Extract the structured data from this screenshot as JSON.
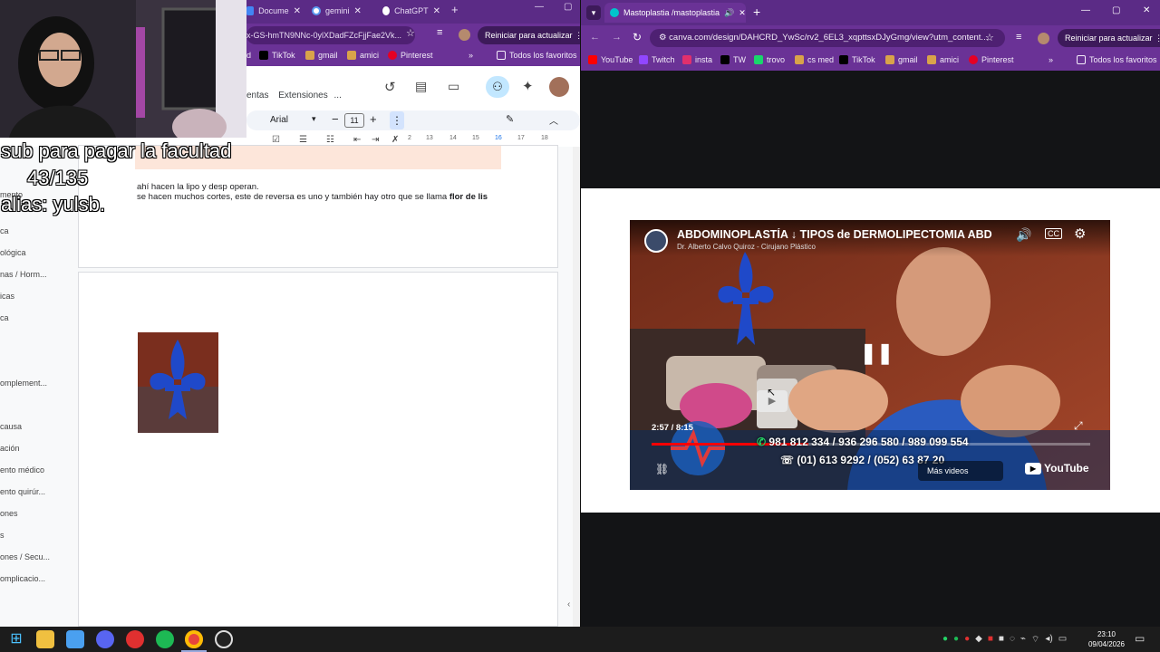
{
  "left_browser": {
    "tabs": [
      {
        "label": "Docume"
      },
      {
        "label": "gemini"
      },
      {
        "label": "ChatGPT"
      }
    ],
    "address": "x-GS-hmTN9NNc-0ylXDadFZcFjjFae2Vk...",
    "update_button": "Reiniciar para actualizar",
    "bookmarks": [
      "d",
      "TikTok",
      "gmail",
      "amici",
      "Pinterest"
    ],
    "all_favorites": "Todos los favoritos"
  },
  "docs": {
    "menu": [
      "entas",
      "Extensiones",
      "..."
    ],
    "font_name": "Arial",
    "font_size": "11",
    "ruler_ticks": [
      "2",
      "13",
      "14",
      "15",
      "16",
      "17",
      "18"
    ],
    "body_line1": "ahí hacen la lipo y desp operan.",
    "body_line2": "se hacen muchos cortes, este de reversa es uno y también hay otro que se llama ",
    "body_bold": "flor de lis",
    "outline": [
      "mento",
      "ca",
      "ológica",
      "nas / Horm...",
      "icas",
      "ca",
      "omplement...",
      "causa",
      "ación",
      "ento médico",
      "ento quirúr...",
      "ones",
      "s",
      "ones / Secu...",
      "omplicacio..."
    ]
  },
  "stream_overlay": {
    "line1": "sub para pagar la facultad",
    "line2": "43/135",
    "line3": "alias: yulsb."
  },
  "right_browser": {
    "tab_title": "Mastoplastia /mastoplastia",
    "address": "canva.com/design/DAHCRD_YwSc/rv2_6EL3_xqpttsxDJyGmg/view?utm_content...",
    "update_button": "Reiniciar para actualizar",
    "bookmarks": [
      "YouTube",
      "Twitch",
      "insta",
      "TW",
      "trovo",
      "cs med",
      "TikTok",
      "gmail",
      "amici",
      "Pinterest"
    ],
    "all_favorites": "Todos los favoritos"
  },
  "video": {
    "title": "ABDOMINOPLASTÍA ↓ TIPOS de DERMOLIPECTOMIA ABD",
    "channel": "Dr. Alberto Calvo Quiroz - Cirujano Plástico",
    "time": "2:57 / 8:15",
    "progress": 0.358,
    "phone1": "981 812 334 / 936 296 580 / 989 099 554",
    "phone2": "(01) 613 9292 / (052) 63 87 20",
    "more_videos": "Más videos",
    "youtube": "YouTube"
  },
  "taskbar": {
    "time": "23:10",
    "date": "09/04/2026"
  },
  "colors": {
    "browser_purple": "#5b2b86",
    "fleur_blue": "#1f49c9"
  }
}
